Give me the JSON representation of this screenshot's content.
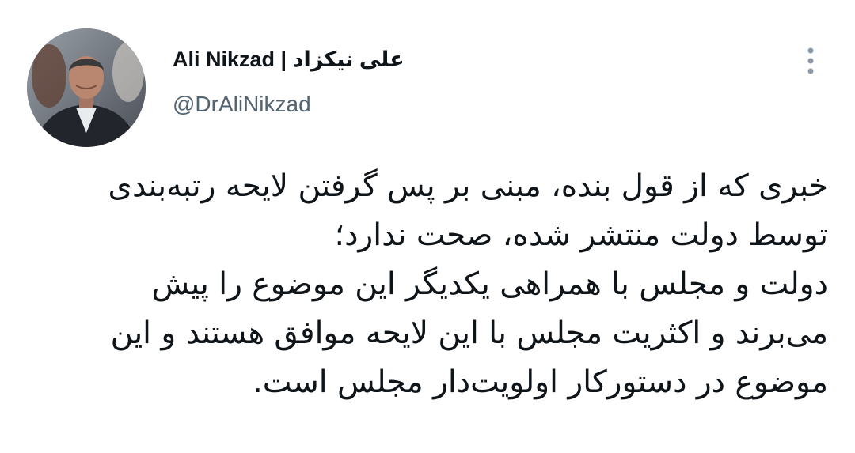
{
  "author": {
    "display_name": "Ali Nikzad | علی نیکزاد",
    "handle": "@DrAliNikzad"
  },
  "icons": {
    "avatar": "profile-photo",
    "more": "more-vertical-icon"
  },
  "colors": {
    "text_primary": "#0f1419",
    "text_secondary": "#536471",
    "icon": "#8b98a5",
    "background": "#ffffff"
  },
  "tweet": {
    "lines": [
      "خبری که از قول بنده، مبنی بر پس گرفتن لایحه رتبه‌بندی",
      "توسط دولت منتشر شده، صحت ندارد؛",
      "دولت و مجلس با همراهی یکدیگر این موضوع را پیش",
      "می‌برند و اکثریت مجلس با این لایحه موافق هستند و این",
      "موضوع در دستورکار اولویت‌دار مجلس است."
    ]
  }
}
